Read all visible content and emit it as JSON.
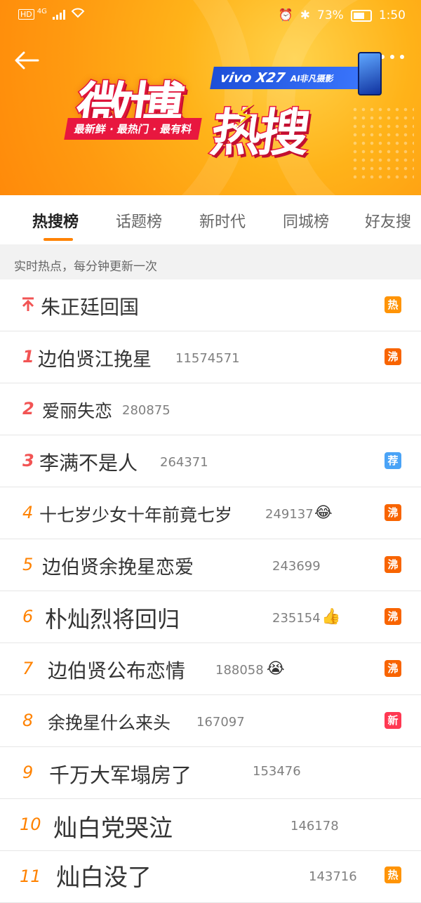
{
  "status_bar": {
    "network": "HD",
    "signal": "4G",
    "battery": "73%",
    "time": "1:50"
  },
  "banner": {
    "logo_part1": "微博",
    "logo_part2": "热搜",
    "tagline": "最新鲜 · 最热门 · 最有料",
    "ad_brand": "vivo X27",
    "ad_sub": "AI非凡摄影"
  },
  "tabs": [
    {
      "label": "热搜榜",
      "active": true
    },
    {
      "label": "话题榜",
      "active": false
    },
    {
      "label": "新时代",
      "active": false
    },
    {
      "label": "同城榜",
      "active": false
    },
    {
      "label": "好友搜",
      "active": false
    }
  ],
  "info_text": "实时热点，每分钟更新一次",
  "list": [
    {
      "rank": "",
      "pinned": true,
      "title": "朱正廷回国",
      "count": "",
      "badge": "热",
      "badge_color": "#ff9406"
    },
    {
      "rank": "1",
      "title": "边伯贤江挽星",
      "count": "11574571",
      "badge": "沸",
      "badge_color": "#f86400"
    },
    {
      "rank": "2",
      "title": "爱丽失恋",
      "count": "280875",
      "badge": "",
      "badge_color": ""
    },
    {
      "rank": "3",
      "title": "李满不是人",
      "count": "264371",
      "badge": "荐",
      "badge_color": "#4aa3f6"
    },
    {
      "rank": "4",
      "title": "十七岁少女十年前竟七岁",
      "count": "249137",
      "emoji": "😂",
      "badge": "沸",
      "badge_color": "#f86400"
    },
    {
      "rank": "5",
      "title": "边伯贤余挽星恋爱",
      "count": "243699",
      "badge": "沸",
      "badge_color": "#f86400"
    },
    {
      "rank": "6",
      "title": "朴灿烈将回归",
      "count": "235154",
      "emoji": "👍",
      "badge": "沸",
      "badge_color": "#f86400"
    },
    {
      "rank": "7",
      "title": "边伯贤公布恋情",
      "count": "188058",
      "emoji": "😭",
      "badge": "沸",
      "badge_color": "#f86400"
    },
    {
      "rank": "8",
      "title": "余挽星什么来头",
      "count": "167097",
      "badge": "新",
      "badge_color": "#ff3852"
    },
    {
      "rank": "9",
      "title": "千万大军塌房了",
      "count": "153476",
      "badge": "",
      "badge_color": ""
    },
    {
      "rank": "10",
      "title": "灿白党哭泣",
      "count": "146178",
      "badge": "",
      "badge_color": ""
    },
    {
      "rank": "11",
      "title": "灿白没了",
      "count": "143716",
      "badge": "热",
      "badge_color": "#ff9406"
    }
  ]
}
